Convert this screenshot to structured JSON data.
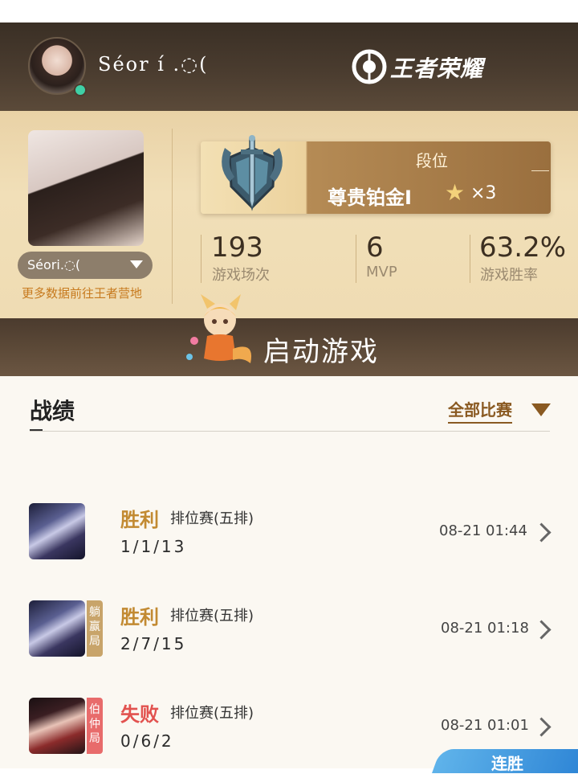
{
  "header": {
    "username": "Séor í .◌(",
    "logo_text": "王者荣耀"
  },
  "profile": {
    "name_pill": "Séori.◌(",
    "camp_link": "更多数据前往王者营地",
    "rank": {
      "label": "段位",
      "name": "尊贵铂金Ⅰ",
      "star_icon": "star-icon",
      "stars": "×3"
    },
    "stats": [
      {
        "value": "193",
        "label": "游戏场次"
      },
      {
        "value": "6",
        "label": "MVP"
      },
      {
        "value": "63.2%",
        "label": "游戏胜率"
      }
    ]
  },
  "launch": {
    "label": "启动游戏"
  },
  "records": {
    "title": "战绩",
    "filter": "全部比赛",
    "matches": [
      {
        "result": "胜利",
        "mode": "排位赛(五排)",
        "kda": "1/1/13",
        "time": "08-21 01:44",
        "tag": ""
      },
      {
        "result": "胜利",
        "mode": "排位赛(五排)",
        "kda": "2/7/15",
        "time": "08-21 01:18",
        "tag": "躺赢局"
      },
      {
        "result": "失败",
        "mode": "排位赛(五排)",
        "kda": "0/6/2",
        "time": "08-21 01:01",
        "tag": "伯仲局"
      }
    ],
    "streak": "连胜"
  },
  "colors": {
    "win": "#c28a32",
    "loss": "#e2524f",
    "header_bg": "#3a2f25",
    "panel_bg": "#efdcb3"
  }
}
